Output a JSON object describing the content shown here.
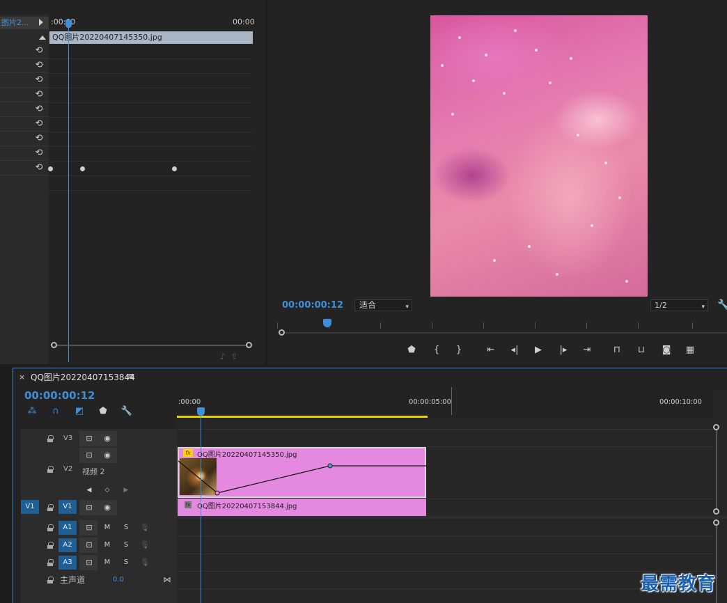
{
  "effect_controls": {
    "source_clip_label": "图片2...",
    "ruler_start": ":00:00",
    "ruler_end": "00:00",
    "clip_name": "QQ图片20220407145350.jpg"
  },
  "program_monitor": {
    "timecode": "00:00:00:12",
    "fit_option": "适合",
    "resolution": "1/2"
  },
  "timeline": {
    "sequence_name": "QQ图片20220407153844",
    "timecode": "00:00:00:12",
    "ruler": [
      ":00:00",
      "00:00:05:00",
      "00:00:10:00"
    ],
    "tracks": {
      "v3": {
        "name": "V3"
      },
      "v2": {
        "name": "V2",
        "label": "视频 2"
      },
      "v1": {
        "source": "V1",
        "name": "V1"
      },
      "a1": {
        "name": "A1",
        "mute": "M",
        "solo": "S"
      },
      "a2": {
        "name": "A2",
        "mute": "M",
        "solo": "S"
      },
      "a3": {
        "name": "A3",
        "mute": "M",
        "solo": "S"
      },
      "master": {
        "name": "主声道",
        "value": "0.0"
      }
    },
    "clips": {
      "v2": {
        "name": "QQ图片20220407145350.jpg",
        "fx": "fx"
      },
      "v1": {
        "name": "QQ图片20220407153844.jpg",
        "fx": "fx"
      }
    }
  },
  "watermark": "最需教育",
  "colors": {
    "accent": "#3f8ed8",
    "clip": "#e589e0",
    "workarea": "#e6d200",
    "toggle": "#1f5f93"
  }
}
